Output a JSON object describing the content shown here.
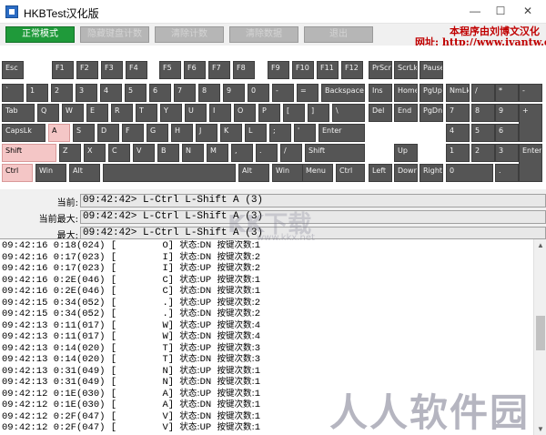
{
  "window": {
    "title": "HKBTest汉化版",
    "minimize": "—",
    "maximize": "☐",
    "close": "✕"
  },
  "toolbar": {
    "normal_mode": "正常模式",
    "hide_keyboard_count": "隐藏键盘计数",
    "clear_count": "清除计数",
    "clear_data": "清除数据",
    "exit": "退出"
  },
  "credit": {
    "line1": "本程序由刘博文汉化",
    "line2": "网址: http://www.ivantw.com"
  },
  "keyboard": {
    "keys": {
      "esc": "Esc",
      "f1": "F1",
      "f2": "F2",
      "f3": "F3",
      "f4": "F4",
      "f5": "F5",
      "f6": "F6",
      "f7": "F7",
      "f8": "F8",
      "f9": "F9",
      "f10": "F10",
      "f11": "F11",
      "f12": "F12",
      "prtscr": "PrScr",
      "scrlk": "ScrLk",
      "pause": "Pause",
      "grave": "`",
      "d1": "1",
      "d2": "2",
      "d3": "3",
      "d4": "4",
      "d5": "5",
      "d6": "6",
      "d7": "7",
      "d8": "8",
      "d9": "9",
      "d0": "0",
      "minus": "-",
      "equal": "=",
      "backspace": "Backspace",
      "ins": "Ins",
      "home": "Home",
      "pgup": "PgUp",
      "numlk": "NmLk",
      "num_div": "/",
      "num_mul": "*",
      "num_sub": "-",
      "tab": "Tab",
      "q": "Q",
      "w": "W",
      "e": "E",
      "r": "R",
      "t": "T",
      "y": "Y",
      "u": "U",
      "i": "I",
      "o": "O",
      "p": "P",
      "lbracket": "[",
      "rbracket": "]",
      "backslash": "\\",
      "del": "Del",
      "end": "End",
      "pgdn": "PgDn",
      "num7": "7",
      "num8": "8",
      "num9": "9",
      "num_add": "+",
      "capslock": "CapsLk",
      "a": "A",
      "s": "S",
      "d": "D",
      "f": "F",
      "g": "G",
      "h": "H",
      "j": "J",
      "k": "K",
      "l": "L",
      "semicolon": ";",
      "quote": "'",
      "enter": "Enter",
      "num4": "4",
      "num5": "5",
      "num6": "6",
      "lshift": "Shift",
      "z": "Z",
      "x": "X",
      "c": "C",
      "v": "V",
      "b": "B",
      "n": "N",
      "m": "M",
      "comma": ",",
      "period": ".",
      "slash": "/",
      "rshift": "Shift",
      "up": "Up",
      "num1": "1",
      "num2": "2",
      "num3": "3",
      "num_enter": "Enter",
      "lctrl": "Ctrl",
      "lwin": "Win",
      "lalt": "Alt",
      "space": "",
      "ralt": "Alt",
      "rwin": "Win",
      "menu": "Menu",
      "rctrl": "Ctrl",
      "left": "Left",
      "down": "Down",
      "right": "Right",
      "num0": "0",
      "num_dot": "."
    },
    "pressed": [
      "a",
      "lshift",
      "lctrl"
    ]
  },
  "status": {
    "current_label": "当前:",
    "current_value": "09:42:42> L-Ctrl L-Shift A (3)",
    "current_max_label": "当前最大:",
    "current_max_value": "09:42:42> L-Ctrl L-Shift A (3)",
    "max_label": "最大:",
    "max_value": "09:42:42> L-Ctrl L-Shift A (3)"
  },
  "log": [
    {
      "time": "09:42:16",
      "code": "0:18(024)",
      "key": "O",
      "state": "DN",
      "count": "1"
    },
    {
      "time": "09:42:16",
      "code": "0:17(023)",
      "key": "I",
      "state": "DN",
      "count": "2"
    },
    {
      "time": "09:42:16",
      "code": "0:17(023)",
      "key": "I",
      "state": "UP",
      "count": "2"
    },
    {
      "time": "09:42:16",
      "code": "0:2E(046)",
      "key": "C",
      "state": "UP",
      "count": "1"
    },
    {
      "time": "09:42:16",
      "code": "0:2E(046)",
      "key": "C",
      "state": "DN",
      "count": "1"
    },
    {
      "time": "09:42:15",
      "code": "0:34(052)",
      "key": ".",
      "state": "UP",
      "count": "2"
    },
    {
      "time": "09:42:15",
      "code": "0:34(052)",
      "key": ".",
      "state": "DN",
      "count": "2"
    },
    {
      "time": "09:42:13",
      "code": "0:11(017)",
      "key": "W",
      "state": "UP",
      "count": "4"
    },
    {
      "time": "09:42:13",
      "code": "0:11(017)",
      "key": "W",
      "state": "DN",
      "count": "4"
    },
    {
      "time": "09:42:13",
      "code": "0:14(020)",
      "key": "T",
      "state": "UP",
      "count": "3"
    },
    {
      "time": "09:42:13",
      "code": "0:14(020)",
      "key": "T",
      "state": "DN",
      "count": "3"
    },
    {
      "time": "09:42:13",
      "code": "0:31(049)",
      "key": "N",
      "state": "UP",
      "count": "1"
    },
    {
      "time": "09:42:13",
      "code": "0:31(049)",
      "key": "N",
      "state": "DN",
      "count": "1"
    },
    {
      "time": "09:42:12",
      "code": "0:1E(030)",
      "key": "A",
      "state": "UP",
      "count": "1"
    },
    {
      "time": "09:42:12",
      "code": "0:1E(030)",
      "key": "A",
      "state": "DN",
      "count": "1"
    },
    {
      "time": "09:42:12",
      "code": "0:2F(047)",
      "key": "V",
      "state": "DN",
      "count": "1"
    },
    {
      "time": "09:42:12",
      "code": "0:2F(047)",
      "key": "V",
      "state": "UP",
      "count": "1"
    }
  ],
  "log_labels": {
    "state": "状态:",
    "count": "按键次数:"
  },
  "watermarks": {
    "top": "KK下载",
    "top_url": "www.kkx.net",
    "bottom": "人人软件园"
  },
  "scrollbar": {
    "up": "▲",
    "down": "▼"
  }
}
